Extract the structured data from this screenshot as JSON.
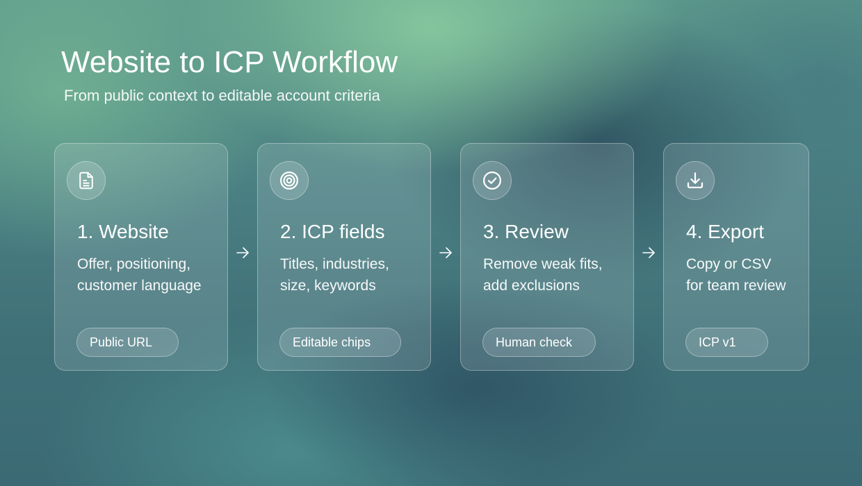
{
  "header": {
    "title": "Website to ICP Workflow",
    "subtitle": "From public context to editable account criteria"
  },
  "steps": [
    {
      "icon": "document-icon",
      "title": "1. Website",
      "desc_lines": [
        "Offer, positioning,",
        "customer language"
      ],
      "chip": "Public URL"
    },
    {
      "icon": "target-icon",
      "title": "2. ICP fields",
      "desc_lines": [
        "Titles, industries,",
        "size, keywords"
      ],
      "chip": "Editable chips"
    },
    {
      "icon": "check-circle-icon",
      "title": "3. Review",
      "desc_lines": [
        "Remove weak fits,",
        "add exclusions"
      ],
      "chip": "Human check"
    },
    {
      "icon": "download-icon",
      "title": "4. Export",
      "desc_lines": [
        "Copy or CSV",
        "for team review"
      ],
      "chip": "ICP v1"
    }
  ],
  "colors": {
    "text": "#ffffff",
    "background_green": "#5e9a8c",
    "background_teal": "#3b6a74"
  }
}
